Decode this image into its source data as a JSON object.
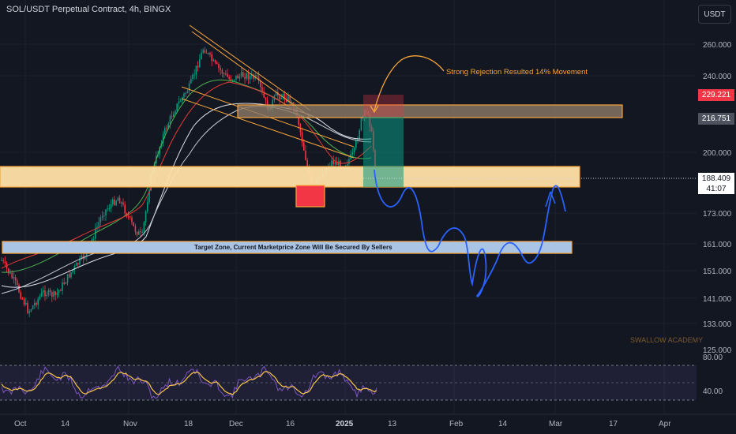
{
  "header": {
    "title": "SOL/USDT Perpetual Contract, 4h, BINGX",
    "currency_button": "USDT"
  },
  "price_axis": {
    "ticks": [
      "260.000",
      "240.000",
      "200.000",
      "173.000",
      "161.000",
      "151.000",
      "141.000",
      "133.000",
      "125.000"
    ],
    "tag_high": "229.221",
    "tag_level": "216.751",
    "tag_current": "188.409",
    "tag_countdown": "41:07"
  },
  "rsi_axis": {
    "ticks": [
      "80.00",
      "40.00"
    ]
  },
  "time_axis": {
    "ticks": [
      "Oct",
      "14",
      "Nov",
      "18",
      "Dec",
      "16",
      "2025",
      "13",
      "Feb",
      "14",
      "Mar",
      "17",
      "Apr"
    ]
  },
  "annotations": {
    "rejection": "Strong Rejection Resulted 14% Movement",
    "target_zone": "Target Zone, Current Marketprice Zone Will Be Secured By Sellers",
    "watermark": "SWALLOW ACADEMY"
  },
  "colors": {
    "background": "#131722",
    "bull": "#089981",
    "bear": "#f23645",
    "zone_orange": "#f7a53a",
    "zone_cream": "#ffe0a8",
    "target_blue": "#a9c4e4",
    "projection": "#2962ff",
    "rsi_line": "#f7c548",
    "rsi_band": "#7e57c2"
  }
}
